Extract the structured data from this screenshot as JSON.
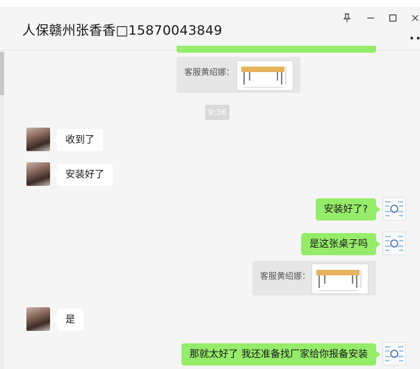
{
  "window": {
    "title": "人保赣州张香香□15870043849",
    "controls": {
      "pin_icon": "pin-icon",
      "minimize_icon": "minimize-icon",
      "maximize_icon": "maximize-icon",
      "close_icon": "close-icon",
      "more_icon": "more-icon"
    }
  },
  "chat": {
    "quote_1": {
      "label": "客服黄绍娜：",
      "image": "table-photo"
    },
    "timestamp": "9:36",
    "msg_1": "收到了",
    "msg_2": "安装好了",
    "msg_3": "安装好了?",
    "msg_4": "是这张桌子吗",
    "quote_2": {
      "label": "客服黄绍娜：",
      "image": "table-photo"
    },
    "msg_5": "是",
    "msg_6": "那就太好了  我还准备找厂家给你报备安装"
  },
  "colors": {
    "outgoing_bubble": "#95ec69",
    "incoming_bubble": "#ffffff",
    "background": "#f5f5f5",
    "quote_bg": "#e6e6e6",
    "table_top": "#e6b35e"
  }
}
